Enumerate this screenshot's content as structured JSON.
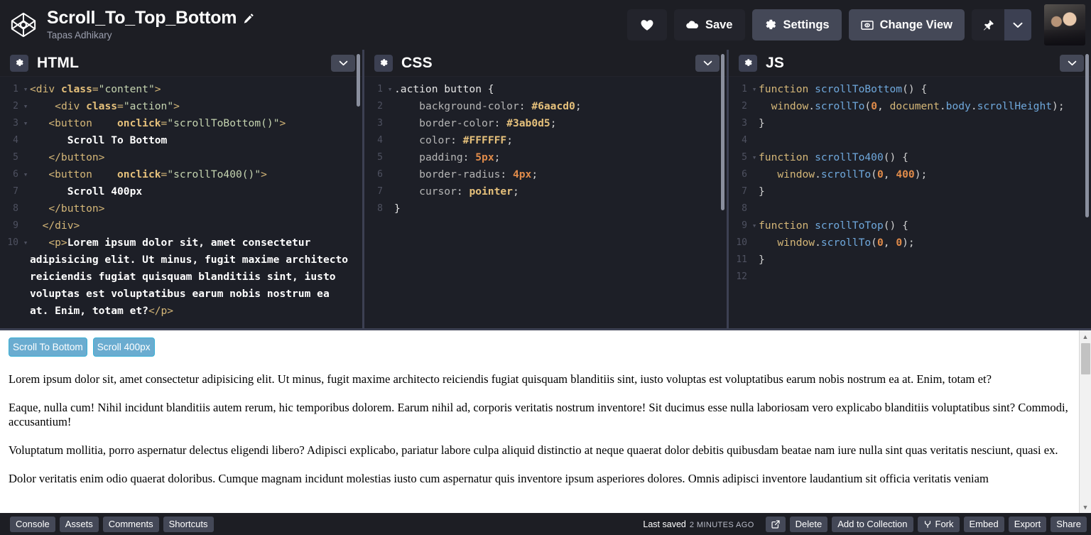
{
  "header": {
    "pen_title": "Scroll_To_Top_Bottom",
    "author": "Tapas Adhikary",
    "logo_icon": "codepen-logo-icon",
    "edit_title_icon": "pencil-icon",
    "buttons": [
      {
        "label": "",
        "icon": "heart-icon",
        "style": "heart"
      },
      {
        "label": "Save",
        "icon": "cloud-icon",
        "style": "dark"
      },
      {
        "label": "Settings",
        "icon": "gear-icon",
        "style": "mid"
      },
      {
        "label": "Change View",
        "icon": "screen-icon",
        "style": "mid"
      }
    ],
    "pin": {
      "icon": "pin-icon",
      "caret_icon": "chevron-down-icon"
    },
    "avatar_alt": "user-avatar"
  },
  "editors": [
    {
      "title": "HTML",
      "gear_icon": "gear-icon",
      "collapse_icon": "chevron-down-icon",
      "lines": [
        {
          "n": "1",
          "fold": true,
          "tokens": [
            {
              "c": "t-tag",
              "t": "<div "
            },
            {
              "c": "t-attr",
              "t": "class"
            },
            {
              "c": "t-tag",
              "t": "="
            },
            {
              "c": "t-str",
              "t": "\"content\""
            },
            {
              "c": "t-tag",
              "t": ">"
            }
          ]
        },
        {
          "n": "2",
          "fold": true,
          "tokens": [
            {
              "c": "t-tag",
              "t": "    <div "
            },
            {
              "c": "t-attr",
              "t": "class"
            },
            {
              "c": "t-tag",
              "t": "="
            },
            {
              "c": "t-str",
              "t": "\"action\""
            },
            {
              "c": "t-tag",
              "t": ">"
            }
          ]
        },
        {
          "n": "3",
          "fold": true,
          "tokens": [
            {
              "c": "t-tag",
              "t": "   <button    "
            },
            {
              "c": "t-attr",
              "t": "onclick"
            },
            {
              "c": "t-tag",
              "t": "="
            },
            {
              "c": "t-str",
              "t": "\"scrollToBottom()\""
            },
            {
              "c": "t-tag",
              "t": ">"
            }
          ]
        },
        {
          "n": "4",
          "fold": false,
          "tokens": [
            {
              "c": "t-txt",
              "t": "      Scroll To Bottom"
            }
          ]
        },
        {
          "n": "5",
          "fold": false,
          "tokens": [
            {
              "c": "t-tag",
              "t": "   </button>"
            }
          ]
        },
        {
          "n": "6",
          "fold": true,
          "tokens": [
            {
              "c": "t-tag",
              "t": "   <button    "
            },
            {
              "c": "t-attr",
              "t": "onclick"
            },
            {
              "c": "t-tag",
              "t": "="
            },
            {
              "c": "t-str",
              "t": "\"scrollTo400()\""
            },
            {
              "c": "t-tag",
              "t": ">"
            }
          ]
        },
        {
          "n": "7",
          "fold": false,
          "tokens": [
            {
              "c": "t-txt",
              "t": "      Scroll 400px"
            }
          ]
        },
        {
          "n": "8",
          "fold": false,
          "tokens": [
            {
              "c": "t-tag",
              "t": "   </button>"
            }
          ]
        },
        {
          "n": "9",
          "fold": false,
          "tokens": [
            {
              "c": "t-tag",
              "t": "  </div>"
            }
          ]
        },
        {
          "n": "10",
          "fold": true,
          "tokens": [
            {
              "c": "t-tag",
              "t": "   <p>"
            },
            {
              "c": "t-txt",
              "t": "Lorem ipsum dolor sit, amet consectetur adipisicing elit. Ut minus, fugit maxime architecto reiciendis fugiat quisquam blanditiis sint, iusto voluptas est voluptatibus earum nobis nostrum ea at. Enim, totam et?"
            },
            {
              "c": "t-tag",
              "t": "</p>"
            }
          ]
        }
      ]
    },
    {
      "title": "CSS",
      "gear_icon": "gear-icon",
      "collapse_icon": "chevron-down-icon",
      "lines": [
        {
          "n": "1",
          "fold": true,
          "tokens": [
            {
              "c": "t-sel",
              "t": ".action button {"
            }
          ]
        },
        {
          "n": "2",
          "fold": false,
          "tokens": [
            {
              "c": "t-prop",
              "t": "    background-color"
            },
            {
              "c": "t-punc",
              "t": ": "
            },
            {
              "c": "t-val",
              "t": "#6aacd0"
            },
            {
              "c": "t-punc",
              "t": ";"
            }
          ]
        },
        {
          "n": "3",
          "fold": false,
          "tokens": [
            {
              "c": "t-prop",
              "t": "    border-color"
            },
            {
              "c": "t-punc",
              "t": ": "
            },
            {
              "c": "t-val",
              "t": "#3ab0d5"
            },
            {
              "c": "t-punc",
              "t": ";"
            }
          ]
        },
        {
          "n": "4",
          "fold": false,
          "tokens": [
            {
              "c": "t-prop",
              "t": "    color"
            },
            {
              "c": "t-punc",
              "t": ": "
            },
            {
              "c": "t-val",
              "t": "#FFFFFF"
            },
            {
              "c": "t-punc",
              "t": ";"
            }
          ]
        },
        {
          "n": "5",
          "fold": false,
          "tokens": [
            {
              "c": "t-prop",
              "t": "    padding"
            },
            {
              "c": "t-punc",
              "t": ": "
            },
            {
              "c": "t-num",
              "t": "5px"
            },
            {
              "c": "t-punc",
              "t": ";"
            }
          ]
        },
        {
          "n": "6",
          "fold": false,
          "tokens": [
            {
              "c": "t-prop",
              "t": "    border-radius"
            },
            {
              "c": "t-punc",
              "t": ": "
            },
            {
              "c": "t-num",
              "t": "4px"
            },
            {
              "c": "t-punc",
              "t": ";"
            }
          ]
        },
        {
          "n": "7",
          "fold": false,
          "tokens": [
            {
              "c": "t-prop",
              "t": "    cursor"
            },
            {
              "c": "t-punc",
              "t": ": "
            },
            {
              "c": "t-val",
              "t": "pointer"
            },
            {
              "c": "t-punc",
              "t": ";"
            }
          ]
        },
        {
          "n": "8",
          "fold": false,
          "tokens": [
            {
              "c": "t-sel",
              "t": "}"
            }
          ]
        }
      ]
    },
    {
      "title": "JS",
      "gear_icon": "gear-icon",
      "collapse_icon": "chevron-down-icon",
      "lines": [
        {
          "n": "1",
          "fold": true,
          "tokens": [
            {
              "c": "t-kw",
              "t": "function "
            },
            {
              "c": "t-fn",
              "t": "scrollToBottom"
            },
            {
              "c": "t-plain",
              "t": "() {"
            }
          ]
        },
        {
          "n": "2",
          "fold": false,
          "tokens": [
            {
              "c": "t-obj",
              "t": "  window"
            },
            {
              "c": "t-plain",
              "t": "."
            },
            {
              "c": "t-fn",
              "t": "scrollTo"
            },
            {
              "c": "t-plain",
              "t": "("
            },
            {
              "c": "t-num",
              "t": "0"
            },
            {
              "c": "t-plain",
              "t": ", "
            },
            {
              "c": "t-obj",
              "t": "document"
            },
            {
              "c": "t-plain",
              "t": "."
            },
            {
              "c": "t-fn",
              "t": "body"
            },
            {
              "c": "t-plain",
              "t": "."
            },
            {
              "c": "t-fn",
              "t": "scrollHeight"
            },
            {
              "c": "t-plain",
              "t": ");"
            }
          ]
        },
        {
          "n": "3",
          "fold": false,
          "tokens": [
            {
              "c": "t-plain",
              "t": "}"
            }
          ]
        },
        {
          "n": "4",
          "fold": false,
          "tokens": [
            {
              "c": "t-plain",
              "t": ""
            }
          ]
        },
        {
          "n": "5",
          "fold": true,
          "tokens": [
            {
              "c": "t-kw",
              "t": "function "
            },
            {
              "c": "t-fn",
              "t": "scrollTo400"
            },
            {
              "c": "t-plain",
              "t": "() {"
            }
          ]
        },
        {
          "n": "6",
          "fold": false,
          "tokens": [
            {
              "c": "t-obj",
              "t": "   window"
            },
            {
              "c": "t-plain",
              "t": "."
            },
            {
              "c": "t-fn",
              "t": "scrollTo"
            },
            {
              "c": "t-plain",
              "t": "("
            },
            {
              "c": "t-num",
              "t": "0"
            },
            {
              "c": "t-plain",
              "t": ", "
            },
            {
              "c": "t-num",
              "t": "400"
            },
            {
              "c": "t-plain",
              "t": ");"
            }
          ]
        },
        {
          "n": "7",
          "fold": false,
          "tokens": [
            {
              "c": "t-plain",
              "t": "}"
            }
          ]
        },
        {
          "n": "8",
          "fold": false,
          "tokens": [
            {
              "c": "t-plain",
              "t": ""
            }
          ]
        },
        {
          "n": "9",
          "fold": true,
          "tokens": [
            {
              "c": "t-kw",
              "t": "function "
            },
            {
              "c": "t-fn",
              "t": "scrollToTop"
            },
            {
              "c": "t-plain",
              "t": "() {"
            }
          ]
        },
        {
          "n": "10",
          "fold": false,
          "tokens": [
            {
              "c": "t-obj",
              "t": "   window"
            },
            {
              "c": "t-plain",
              "t": "."
            },
            {
              "c": "t-fn",
              "t": "scrollTo"
            },
            {
              "c": "t-plain",
              "t": "("
            },
            {
              "c": "t-num",
              "t": "0"
            },
            {
              "c": "t-plain",
              "t": ", "
            },
            {
              "c": "t-num",
              "t": "0"
            },
            {
              "c": "t-plain",
              "t": ");"
            }
          ]
        },
        {
          "n": "11",
          "fold": false,
          "tokens": [
            {
              "c": "t-plain",
              "t": "}"
            }
          ]
        },
        {
          "n": "12",
          "fold": false,
          "tokens": [
            {
              "c": "t-plain",
              "t": ""
            }
          ]
        }
      ]
    }
  ],
  "preview": {
    "buttons": [
      {
        "label": "Scroll To Bottom"
      },
      {
        "label": "Scroll 400px"
      }
    ],
    "paragraphs": [
      "Lorem ipsum dolor sit, amet consectetur adipisicing elit. Ut minus, fugit maxime architecto reiciendis fugiat quisquam blanditiis sint, iusto voluptas est voluptatibus earum nobis nostrum ea at. Enim, totam et?",
      "Eaque, nulla cum! Nihil incidunt blanditiis autem rerum, hic temporibus dolorem. Earum nihil ad, corporis veritatis nostrum inventore! Sit ducimus esse nulla laboriosam vero explicabo blanditiis voluptatibus sint? Commodi, accusantium!",
      "Voluptatum mollitia, porro aspernatur delectus eligendi libero? Adipisci explicabo, pariatur labore culpa aliquid distinctio at neque quaerat dolor debitis quibusdam beatae nam iure nulla sint quas veritatis nesciunt, quasi ex.",
      "Dolor veritatis enim odio quaerat doloribus. Cumque magnam incidunt molestias iusto cum aspernatur quis inventore ipsum asperiores dolores. Omnis adipisci inventore laudantium sit officia veritatis veniam"
    ],
    "scroll_up_icon": "scroll-up-arrow-icon",
    "scroll_down_icon": "scroll-down-arrow-icon"
  },
  "bottombar": {
    "left_buttons": [
      {
        "label": "Console"
      },
      {
        "label": "Assets"
      },
      {
        "label": "Comments"
      },
      {
        "label": "Shortcuts"
      }
    ],
    "saved_label": "Last saved",
    "saved_ago": "2 minutes ago",
    "right_buttons": [
      {
        "label": "",
        "icon": "open-external-icon"
      },
      {
        "label": "Delete",
        "icon": ""
      },
      {
        "label": "Add to Collection",
        "icon": ""
      },
      {
        "label": "Fork",
        "icon": "fork-icon"
      },
      {
        "label": "Embed",
        "icon": ""
      },
      {
        "label": "Export",
        "icon": ""
      },
      {
        "label": "Share",
        "icon": ""
      }
    ]
  },
  "colors": {
    "accent": "#6aacd0",
    "accent_border": "#3ab0d5",
    "chrome_dark": "#1d1e24",
    "chrome_mid": "#444857",
    "divider": "#3c4052"
  }
}
